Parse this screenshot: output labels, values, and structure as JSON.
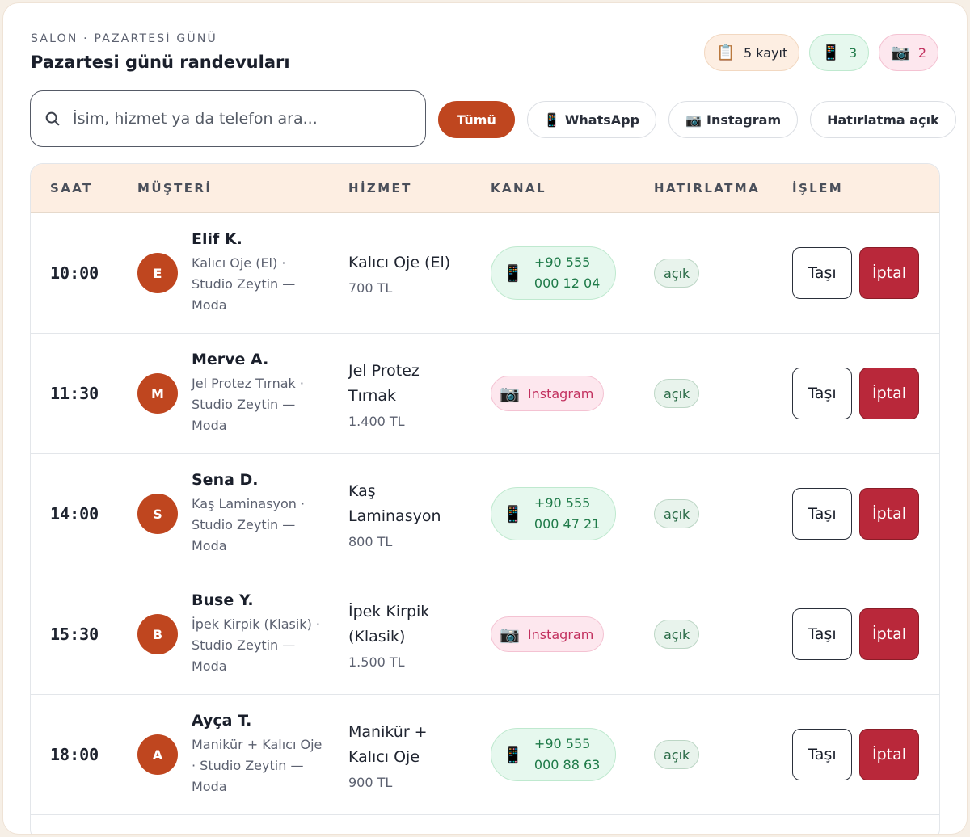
{
  "header": {
    "eyebrow": "SALON · PAZARTESİ GÜNÜ",
    "title": "Pazartesi günü randevuları"
  },
  "badges": {
    "count": {
      "icon": "clipboard-icon",
      "label": "5 kayıt"
    },
    "whatsapp": {
      "icon": "phone-icon",
      "label": "3"
    },
    "instagram": {
      "icon": "camera-icon",
      "label": "2"
    }
  },
  "search": {
    "placeholder": "İsim, hizmet ya da telefon ara...",
    "value": ""
  },
  "filters": {
    "all": "Tümü",
    "whatsapp": "WhatsApp",
    "instagram": "Instagram",
    "reminder": "Hatırlatma açık"
  },
  "columns": {
    "time": "SAAT",
    "customer": "MÜŞTERİ",
    "service": "HİZMET",
    "channel": "KANAL",
    "reminder": "HATIRLATMA",
    "action": "İŞLEM"
  },
  "actions": {
    "move": "Taşı",
    "cancel": "İptal"
  },
  "rows": [
    {
      "time": "10:00",
      "initial": "E",
      "name": "Elif K.",
      "detail": "Kalıcı Oje (El) · Studio Zeytin — Moda",
      "service": "Kalıcı Oje (El)",
      "price": "700 TL",
      "channel": "whatsapp",
      "contact": "+90 555 000 12 04",
      "reminder": "açık"
    },
    {
      "time": "11:30",
      "initial": "M",
      "name": "Merve A.",
      "detail": "Jel Protez Tırnak · Studio Zeytin — Moda",
      "service": "Jel Protez Tırnak",
      "price": "1.400 TL",
      "channel": "instagram",
      "contact": "Instagram",
      "reminder": "açık"
    },
    {
      "time": "14:00",
      "initial": "S",
      "name": "Sena D.",
      "detail": "Kaş Laminasyon · Studio Zeytin — Moda",
      "service": "Kaş Laminasyon",
      "price": "800 TL",
      "channel": "whatsapp",
      "contact": "+90 555 000 47 21",
      "reminder": "açık"
    },
    {
      "time": "15:30",
      "initial": "B",
      "name": "Buse Y.",
      "detail": "İpek Kirpik (Klasik) · Studio Zeytin — Moda",
      "service": "İpek Kirpik (Klasik)",
      "price": "1.500 TL",
      "channel": "instagram",
      "contact": "Instagram",
      "reminder": "açık"
    },
    {
      "time": "18:00",
      "initial": "A",
      "name": "Ayça T.",
      "detail": "Manikür + Kalıcı Oje · Studio Zeytin — Moda",
      "service": "Manikür + Kalıcı Oje",
      "price": "900 TL",
      "channel": "whatsapp",
      "contact": "+90 555 000 88 63",
      "reminder": "açık"
    }
  ],
  "colors": {
    "accent": "#bf461f",
    "danger": "#b9283a",
    "whatsapp": "#1e7a48",
    "instagram": "#c2305e",
    "header_bg": "#fdeee2"
  }
}
